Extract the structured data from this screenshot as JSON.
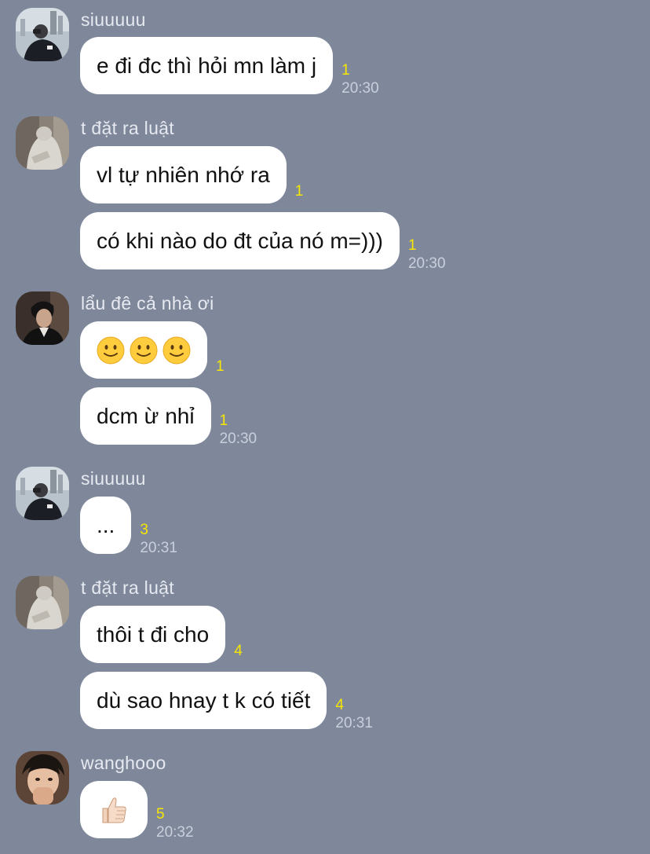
{
  "colors": {
    "background": "#7f889b",
    "bubble": "#ffffff",
    "read_count": "#f7e600",
    "sender_name": "#e6e9f0",
    "timestamp": "#c9cfdb"
  },
  "groups": [
    {
      "sender": "siuuuuu",
      "avatar_icon": "avatar-cityscape-icon",
      "messages": [
        {
          "text": "e đi đc thì hỏi mn làm j",
          "read": "1",
          "time": "20:30"
        }
      ]
    },
    {
      "sender": "t đặt ra luật",
      "avatar_icon": "avatar-hoodie-icon",
      "messages": [
        {
          "text": "vl tự nhiên nhớ ra",
          "read": "1",
          "time": ""
        },
        {
          "text": "có khi nào do đt của nó m=)))",
          "read": "1",
          "time": "20:30"
        }
      ]
    },
    {
      "sender": "lẩu đê cả nhà ơi",
      "avatar_icon": "avatar-portrait-icon",
      "messages": [
        {
          "emoji": [
            "slightly-smiling-face-icon",
            "slightly-smiling-face-icon",
            "slightly-smiling-face-icon"
          ],
          "read": "1",
          "time": ""
        },
        {
          "text": "dcm ừ nhỉ",
          "read": "1",
          "time": "20:30"
        }
      ]
    },
    {
      "sender": "siuuuuu",
      "avatar_icon": "avatar-cityscape-icon",
      "messages": [
        {
          "text": "...",
          "read": "3",
          "time": "20:31"
        }
      ]
    },
    {
      "sender": "t đặt ra luật",
      "avatar_icon": "avatar-hoodie-icon",
      "messages": [
        {
          "text": "thôi t đi cho",
          "read": "4",
          "time": ""
        },
        {
          "text": "dù sao hnay t k có tiết",
          "read": "4",
          "time": "20:31"
        }
      ]
    },
    {
      "sender": "wanghooo",
      "avatar_icon": "avatar-selfie-icon",
      "messages": [
        {
          "emoji": [
            "thumbs-up-icon"
          ],
          "read": "5",
          "time": "20:32"
        }
      ]
    }
  ]
}
